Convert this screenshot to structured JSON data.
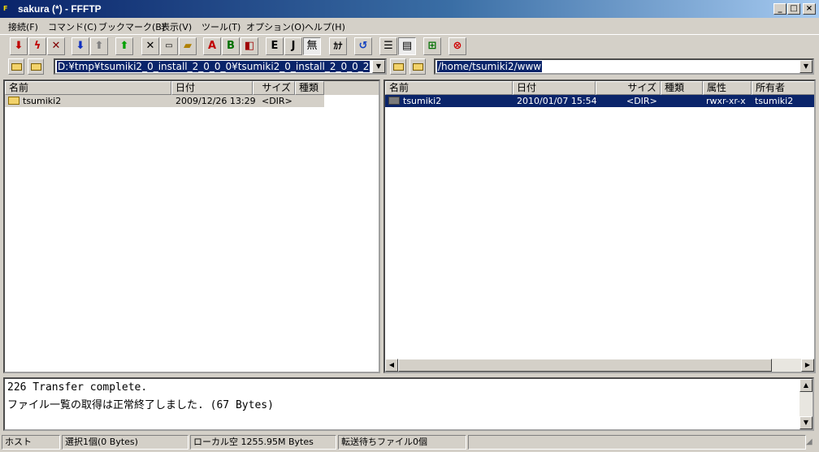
{
  "window": {
    "title": "sakura (*) - FFFTP",
    "app_icon": "ftp-icon",
    "controls": [
      "minimize-icon",
      "maximize-icon",
      "close-icon"
    ]
  },
  "menu": [
    "接続(F)",
    "コマンド(C)",
    "ブックマーク(B)",
    "表示(V)",
    "ツール(T)",
    "オプション(O)",
    "ヘルプ(H)"
  ],
  "toolbar": {
    "icons": [
      "connect-icon",
      "quick-connect-icon",
      "disconnect-icon",
      "download-icon",
      "upload-icon",
      "mirror-upload-icon",
      "delete-icon",
      "rename-icon",
      "new-folder-icon",
      "ascii-mode-icon",
      "binary-mode-icon",
      "auto-mode-icon",
      "exec-icon",
      "jis-icon",
      "no-convert-icon",
      "kana-icon",
      "refresh-icon",
      "list-view-icon",
      "detail-view-icon",
      "sync-folders-icon",
      "stop-icon"
    ],
    "glyphs": {
      "ascii": "A",
      "binary": "B",
      "exec": "E",
      "jis": "J",
      "no_convert": "無",
      "kana": "ｶﾅ"
    }
  },
  "local": {
    "path": "D:¥tmp¥tsumiki2_0_install_2_0_0_0¥tsumiki2_0_install_2_0_0_2",
    "columns": [
      "名前",
      "日付",
      "サイズ",
      "種類"
    ],
    "files": [
      {
        "name": "tsumiki2",
        "date": "2009/12/26 13:29",
        "size": "<DIR>",
        "type": ""
      }
    ]
  },
  "remote": {
    "path": "/home/tsumiki2/www",
    "columns": [
      "名前",
      "日付",
      "サイズ",
      "種類",
      "属性",
      "所有者"
    ],
    "files": [
      {
        "name": "tsumiki2",
        "date": "2010/01/07 15:54",
        "size": "<DIR>",
        "type": "",
        "attr": "rwxr-xr-x",
        "owner": "tsumiki2"
      }
    ]
  },
  "log": [
    "226 Transfer complete.",
    "ファイル一覧の取得は正常終了しました. (67 Bytes)"
  ],
  "status": {
    "host": "ホスト",
    "selected": "選択1個(0 Bytes)",
    "local_free": "ローカル空 1255.95M Bytes",
    "queue": "転送待ちファイル0個",
    "extra": ""
  },
  "colors": {
    "selection": "#0a246a",
    "title_start": "#0a246a",
    "face": "#d4d0c8"
  }
}
